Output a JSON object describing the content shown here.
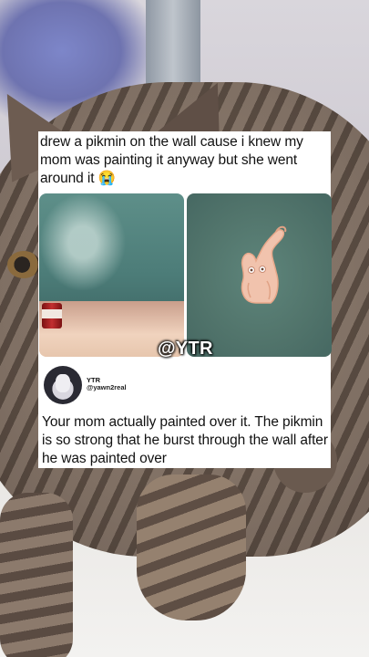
{
  "post": {
    "caption": "drew a pikmin on the wall cause i knew my mom was painting it anyway but she went around it 😭",
    "watermark": "@YTR",
    "photos": [
      {
        "label": "wall-painted-around-drawing"
      },
      {
        "label": "pikmin-drawing-on-wall"
      }
    ]
  },
  "reply": {
    "name": "YTR",
    "handle": "@yawn2real",
    "text": "Your mom actually painted over it. The pikmin is so strong that he burst through the wall after he was painted over"
  },
  "colors": {
    "wall_green": "#52756c",
    "pikmin_fill": "#f1c3ad",
    "card_bg": "#ffffff"
  }
}
